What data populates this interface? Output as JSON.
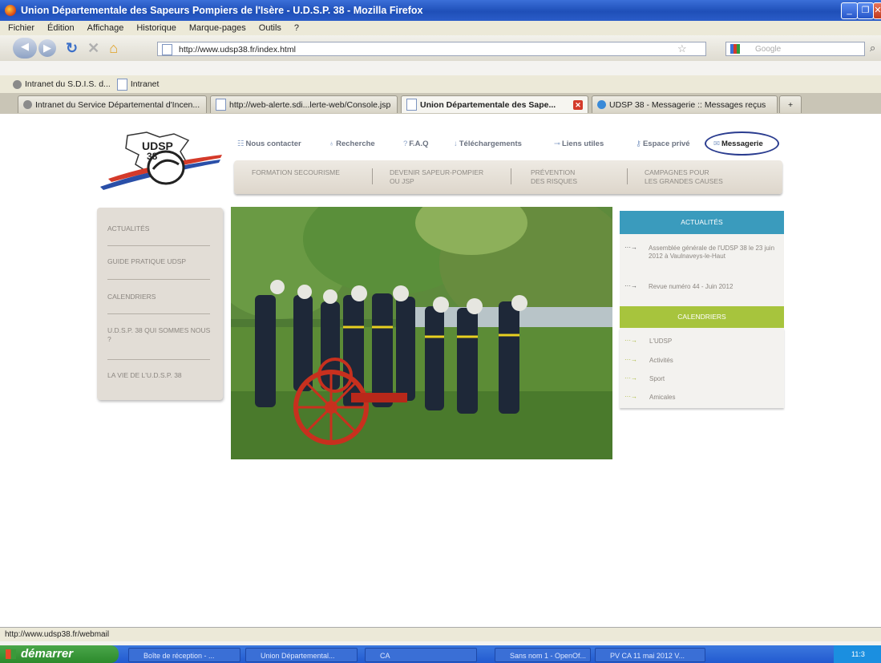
{
  "window": {
    "title": "Union Départementale des Sapeurs Pompiers de l'Isère - U.D.S.P. 38 - Mozilla Firefox"
  },
  "menu": [
    "Fichier",
    "Édition",
    "Affichage",
    "Historique",
    "Marque-pages",
    "Outils",
    "?"
  ],
  "url": "http://www.udsp38.fr/index.html",
  "search_placeholder": "Google",
  "bookmarks": [
    "Intranet du S.D.I.S. d...",
    "Intranet"
  ],
  "tabs": [
    {
      "label": "Intranet du Service Départemental d'Incen..."
    },
    {
      "label": "http://web-alerte.sdi...lerte-web/Console.jsp"
    },
    {
      "label": "Union Départementale des Sape..."
    },
    {
      "label": "UDSP 38 - Messagerie :: Messages reçus"
    }
  ],
  "logo": {
    "text": "UDSP",
    "num": "38"
  },
  "topnav": [
    "Nous contacter",
    "Recherche",
    "F.A.Q",
    "Téléchargements",
    "Liens utiles",
    "Espace privé",
    "Messagerie"
  ],
  "submenu": [
    {
      "l1": "FORMATION SECOURISME",
      "l2": ""
    },
    {
      "l1": "DEVENIR SAPEUR-POMPIER",
      "l2": "OU JSP"
    },
    {
      "l1": "PRÉVENTION",
      "l2": "DES RISQUES"
    },
    {
      "l1": "CAMPAGNES POUR",
      "l2": "LES GRANDES CAUSES"
    }
  ],
  "leftmenu": [
    "ACTUALITÉS",
    "GUIDE PRATIQUE UDSP",
    "CALENDRIERS",
    "U.D.S.P. 38 QUI SOMMES NOUS ?",
    "LA VIE DE L'U.D.S.P. 38"
  ],
  "actualites": {
    "title": "ACTUALITÉS",
    "items": [
      "Assemblée générale de l'UDSP 38 le 23 juin 2012 à Vaulnaveys-le-Haut",
      "Revue numéro 44 - Juin 2012"
    ]
  },
  "calendriers": {
    "title": "CALENDRIERS",
    "items": [
      "L'UDSP",
      "Activités",
      "Sport",
      "Amicales"
    ]
  },
  "status": "http://www.udsp38.fr/webmail",
  "start": "démarrer",
  "taskbar": [
    "Boîte de réception - ...",
    "Union Départemental...",
    "CA",
    "Sans nom 1 - OpenOf...",
    "PV CA 11 mai 2012 V..."
  ],
  "clock": "11:3",
  "colors": {
    "actus": "#3a9bbd",
    "calendriers": "#a7c43d",
    "titlebar": "#1f4fb8"
  }
}
